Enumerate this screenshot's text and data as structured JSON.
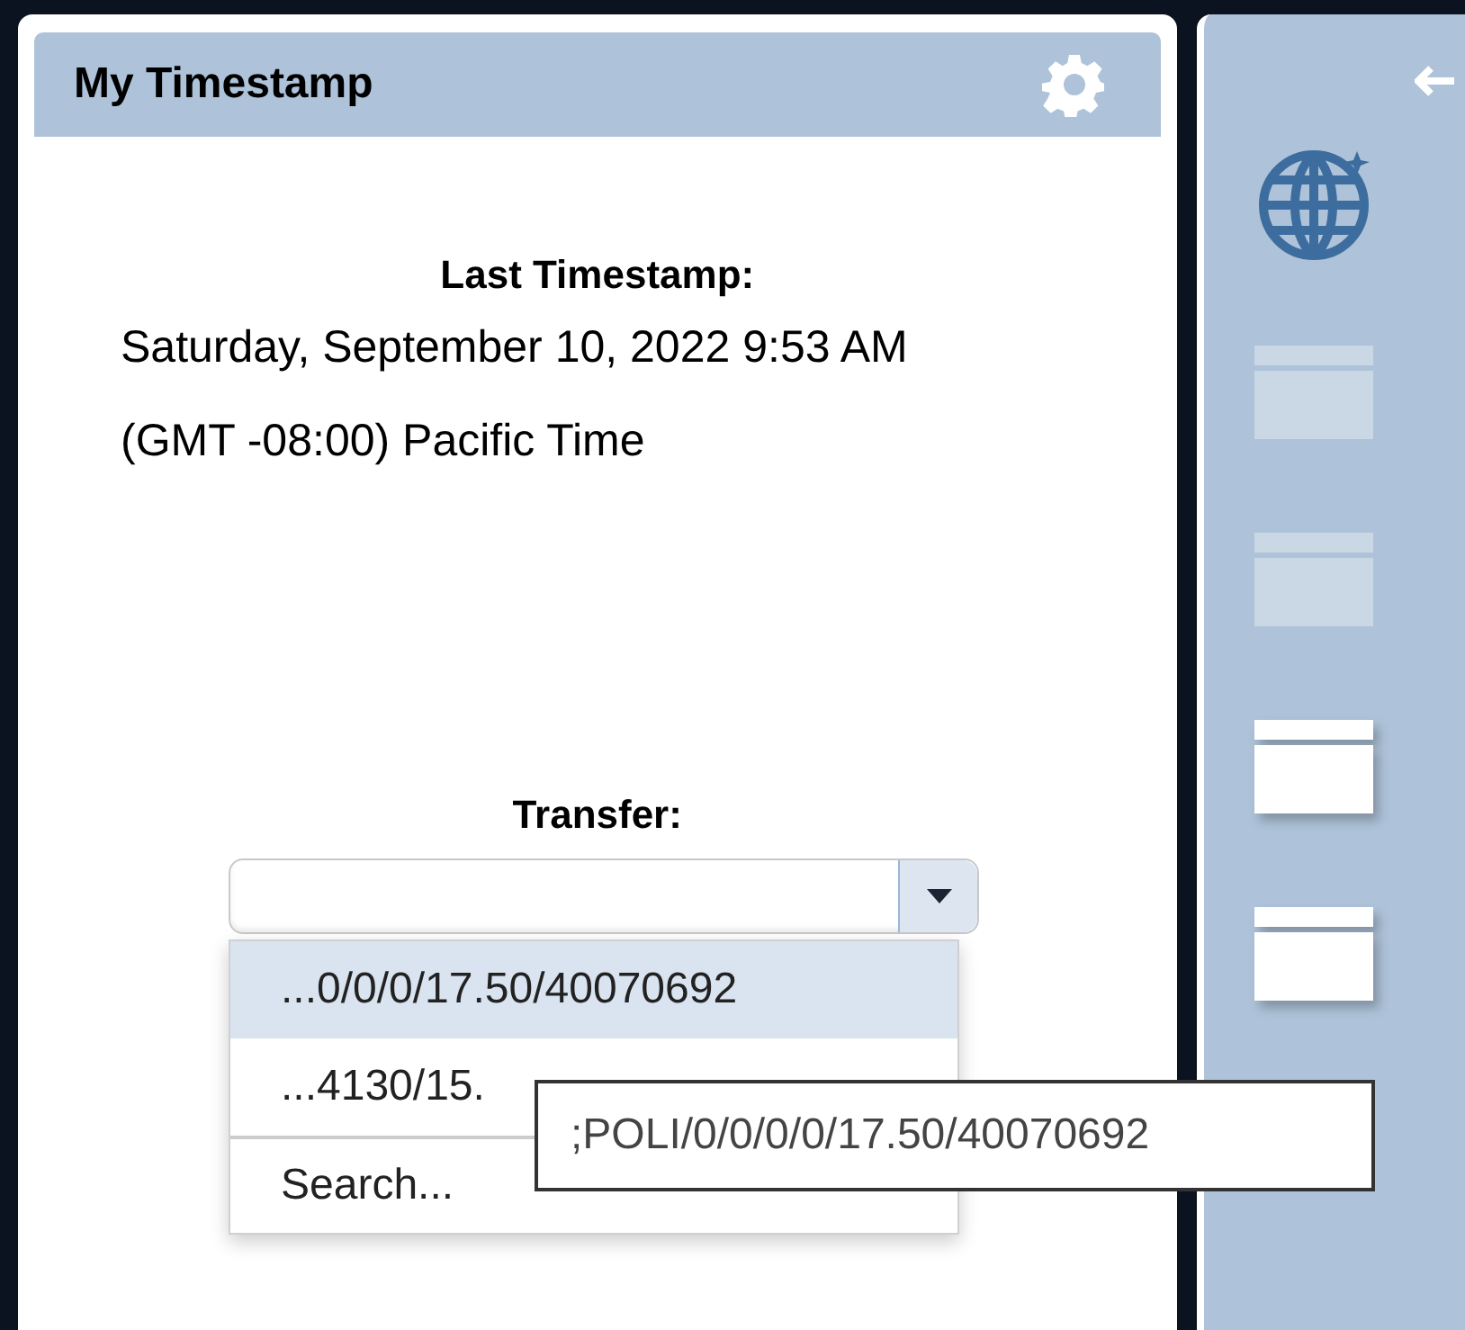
{
  "panel": {
    "title": "My Timestamp"
  },
  "last_timestamp": {
    "label": "Last Timestamp:",
    "date": "Saturday, September 10, 2022 9:53 AM",
    "timezone": "(GMT -08:00) Pacific Time"
  },
  "transfer": {
    "label": "Transfer:",
    "options": [
      {
        "kind": "option",
        "text": "...0/0/0/17.50/40070692",
        "selected": true
      },
      {
        "kind": "option",
        "text": "...4130/15.",
        "selected": false
      },
      {
        "kind": "action",
        "text": "Search...",
        "selected": false
      }
    ],
    "tooltip": ";POLI/0/0/0/0/17.50/40070692"
  },
  "sidebar": {
    "tiles": [
      {
        "active": false
      },
      {
        "active": false
      },
      {
        "active": true
      },
      {
        "active": true
      }
    ]
  }
}
